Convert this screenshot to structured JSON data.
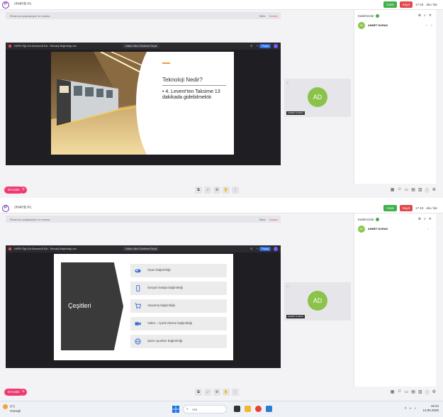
{
  "app": {
    "logo": "P",
    "title": "//H4P/B Pc"
  },
  "header": {
    "live_label": "Canlı",
    "rec_label": "Kayıt",
    "timer_top": "17:19",
    "timer_bottom": "17:19",
    "user_label": "ahu ’ilar"
  },
  "notice": {
    "text": "Ekranınız paylaşılıyor ve sınava",
    "allow": "Dikte",
    "deny": "Durdur"
  },
  "share_top": {
    "title": "HAPEI Öğr.Gör.Kavramı/S.Kör...Teknoloji Bağımlılığı.onu",
    "pill": "Kalkan Video Gönderme Sinyal",
    "play": "Paylaş"
  },
  "share_bottom": {
    "title": "HAPEI Öğr.Gör.Kavramı/S.Kör...Teknoloji Bağımlılığı.onu",
    "pill": "Kalkan Video Gönderme Sinyal",
    "play": "Paylaş"
  },
  "slide1": {
    "heading": "Teknoloji Nedir?",
    "bullet": "• 4. Levent’ten Taksime 13 dakikada gidebilmektir."
  },
  "slide2": {
    "title": "Çeşitleri",
    "items": [
      {
        "label": "Oyun bağımlılığı",
        "icon": "gamepad-icon",
        "color": "#3b6fd4"
      },
      {
        "label": "Sosyal medya bağımlılığı",
        "icon": "phone-icon",
        "color": "#3b6fd4"
      },
      {
        "label": "Alışveriş bağımlılığı",
        "icon": "cart-icon",
        "color": "#3b6fd4"
      },
      {
        "label": "Video – içerik izleme bağımlılığı",
        "icon": "video-icon",
        "color": "#3b6fd4"
      },
      {
        "label": "Şans oyunları bağımlılığı",
        "icon": "globe-icon",
        "color": "#3b6fd4"
      }
    ]
  },
  "participant": {
    "initials": "AD",
    "name": "AHMET DURAK",
    "tile_name": "AHMET DURAK"
  },
  "panel": {
    "heading": "Katılımcılar"
  },
  "controls": {
    "el_button": "El Kaldır",
    "plus": "+"
  },
  "taskbar": {
    "weather_temp": "9°C",
    "weather_desc": "Güneşli",
    "search_placeholder": "Ara",
    "time": "18:24",
    "date": "13.05.2025"
  },
  "colors": {
    "accent_pink": "#ef3a72",
    "live_green": "#3fb04a",
    "rec_red": "#e2484d",
    "avatar_green": "#8bc34a"
  }
}
